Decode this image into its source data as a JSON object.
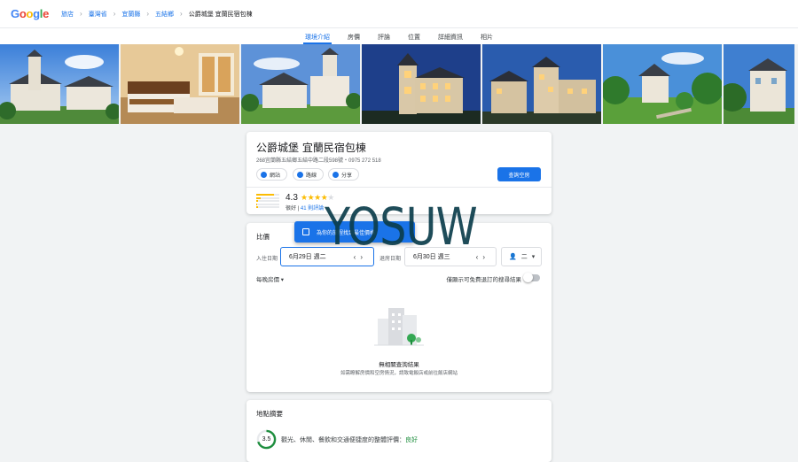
{
  "logo": {
    "g1": "G",
    "o1": "o",
    "o2": "o",
    "g2": "g",
    "l": "l",
    "e": "e"
  },
  "breadcrumb": [
    "旅店",
    "臺灣省",
    "宜蘭縣",
    "五結鄉",
    "公爵城堡 宜蘭民宿包棟"
  ],
  "tabs": [
    {
      "label": "環境介紹",
      "active": true
    },
    {
      "label": "房價",
      "active": false
    },
    {
      "label": "評論",
      "active": false
    },
    {
      "label": "位置",
      "active": false
    },
    {
      "label": "詳細資訊",
      "active": false
    },
    {
      "label": "相片",
      "active": false
    }
  ],
  "hotel": {
    "name": "公爵城堡 宜蘭民宿包棟",
    "address": "268宜蘭縣五結鄉五結中路二段598號・0975 272 518",
    "actions": [
      "網站",
      "路線",
      "分享"
    ],
    "check_button": "查詢空房",
    "rating": "4.3",
    "rating_stars": 4,
    "rating_word": "很好",
    "review_link": "41 則評論",
    "rating_distribution": [
      0.75,
      0.2,
      0.06,
      0.03,
      0.06
    ]
  },
  "pricing": {
    "title": "比價",
    "toast": "為你的旅程找到最佳價格",
    "checkin_label": "入住日期",
    "checkin": "6月29日 週二",
    "checkout_label": "退房日期",
    "checkout": "6月30日 週三",
    "guests": "二",
    "per_night": "每晚房價",
    "toggle_label": "僅顯示可免費退訂的搜尋結果",
    "no_results": "無相關查詢結果",
    "no_results_sub": "如需瞭解房價和空房情況，請致電飯店或前往飯店網站"
  },
  "location": {
    "title": "地點摘要",
    "score": "3.5",
    "score_fraction": 0.7,
    "desc": "觀光、休閒、餐飲和交通便捷度的整體評價：",
    "verdict": "良好"
  },
  "watermark": "YOSUW",
  "colors": {
    "accent": "#1a73e8",
    "star": "#fbbc04",
    "good": "#1e8e3e",
    "watermark": "#0b3d4c"
  }
}
